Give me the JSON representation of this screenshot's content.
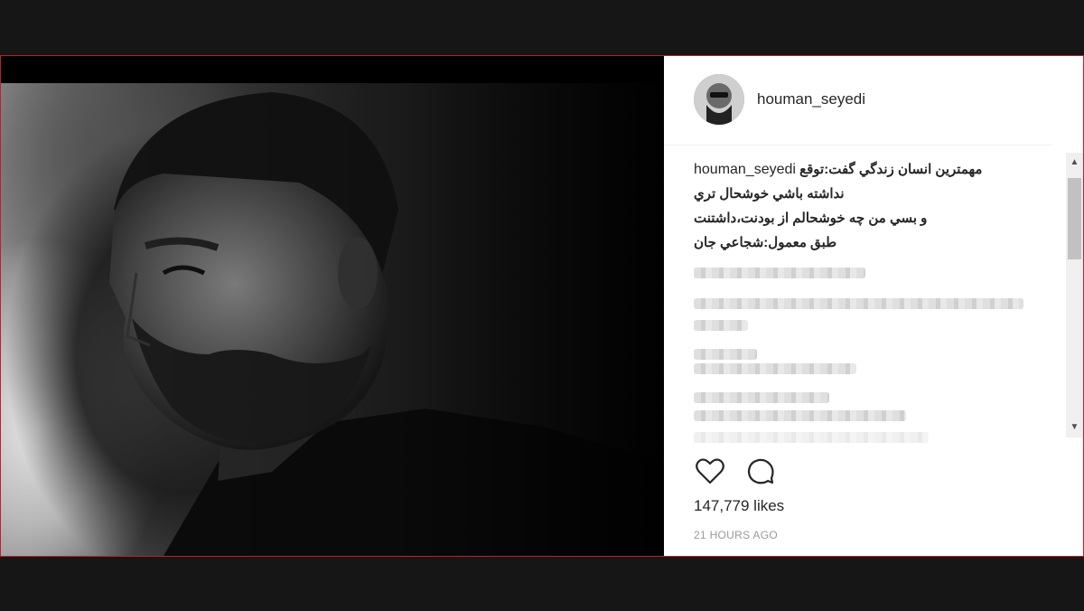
{
  "post": {
    "username": "houman_seyedi",
    "caption_username": "houman_seyedi",
    "caption_lines": [
      "مهمترين انسان زندگي گفت:توقع",
      "نداشته باشي خوشحال تري",
      "و بسي من چه خوشحالم از بودنت،داشتنت",
      "طبق معمول:شجاعي جان"
    ],
    "likes": "147,779 likes",
    "time": "21 HOURS AGO"
  },
  "icons": {
    "like": "heart-icon",
    "comment": "comment-icon",
    "scroll_up": "scroll-up-arrow-icon",
    "scroll_down": "scroll-down-arrow-icon"
  },
  "colors": {
    "frame_border": "#c0202a",
    "text": "#262626",
    "muted": "#999999"
  }
}
